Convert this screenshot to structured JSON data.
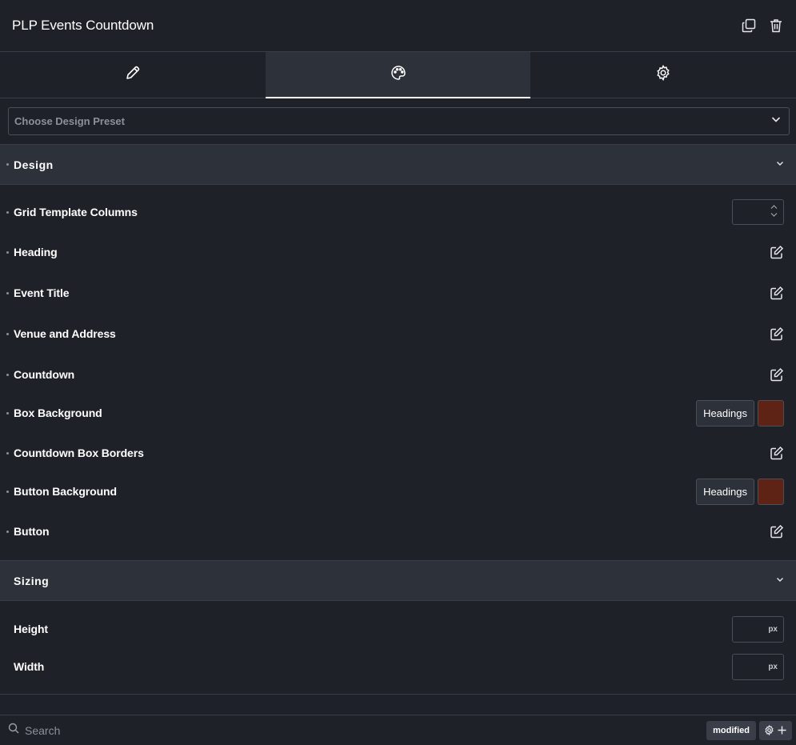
{
  "header": {
    "title": "PLP Events Countdown",
    "icons": [
      "duplicate-icon",
      "trash-icon"
    ]
  },
  "tabs": [
    {
      "name": "content",
      "icon": "pencil-icon",
      "active": false
    },
    {
      "name": "style",
      "icon": "palette-icon",
      "active": true
    },
    {
      "name": "advanced",
      "icon": "gear-icon",
      "active": false
    }
  ],
  "preset": {
    "placeholder": "Choose Design Preset"
  },
  "design": {
    "title": "Design",
    "rows": {
      "grid_template_columns": "Grid Template Columns",
      "heading": "Heading",
      "event_title": "Event Title",
      "venue_and_address": "Venue and Address",
      "countdown": "Countdown",
      "box_background": "Box Background",
      "countdown_box_borders": "Countdown Box Borders",
      "button_background": "Button Background",
      "button": "Button"
    },
    "box_background": {
      "tag": "Headings",
      "color": "#5e2314"
    },
    "button_background": {
      "tag": "Headings",
      "color": "#5e2314"
    }
  },
  "sizing": {
    "title": "Sizing",
    "height": {
      "label": "Height",
      "unit": "px"
    },
    "width": {
      "label": "Width",
      "unit": "px"
    }
  },
  "footer": {
    "search_placeholder": "Search",
    "modified_label": "modified"
  },
  "colors": {
    "background": "#1f2129",
    "section": "#2d313a",
    "border": "#3a3d47",
    "accent_swatch": "#5e2314"
  }
}
